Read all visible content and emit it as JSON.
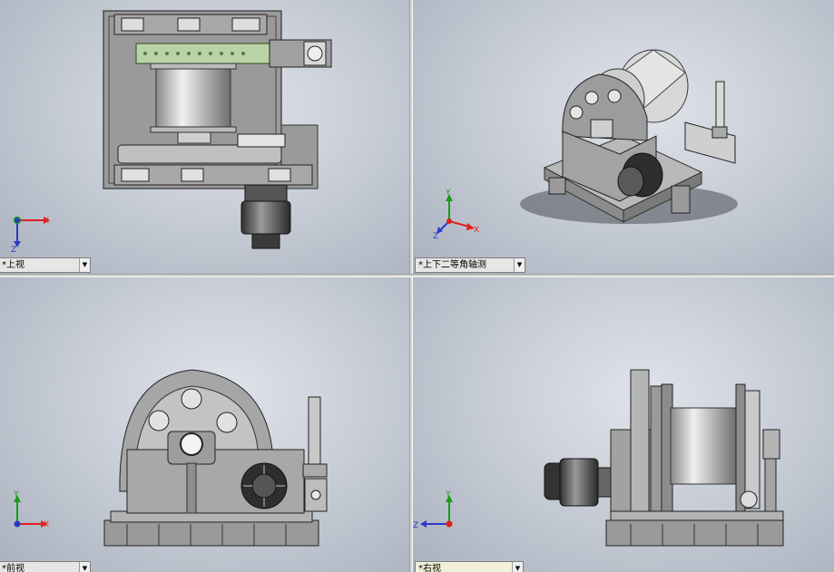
{
  "viewports": [
    {
      "id": "top-left",
      "view_label": "*上视",
      "dropdown_glyph": "▼",
      "triad_axes": [
        "X",
        "Z"
      ]
    },
    {
      "id": "top-right",
      "view_label": "*上下二等角轴测",
      "dropdown_glyph": "▼",
      "triad_axes": [
        "Y",
        "Z",
        "X"
      ]
    },
    {
      "id": "bottom-left",
      "view_label": "*前视",
      "dropdown_glyph": "▼",
      "triad_axes": [
        "Y",
        "X"
      ]
    },
    {
      "id": "bottom-right",
      "view_label": "*右视",
      "dropdown_glyph": "▼",
      "triad_axes": [
        "Y",
        "Z"
      ]
    }
  ],
  "colors": {
    "viewport_bg": "#c3c9d3",
    "axis_x": "#e02020",
    "axis_y": "#1a9a1a",
    "axis_z": "#2a3ac8",
    "model_gray": "#8f8f8f"
  },
  "icons": [
    "dropdown-arrow-icon",
    "view-triad-icon"
  ]
}
